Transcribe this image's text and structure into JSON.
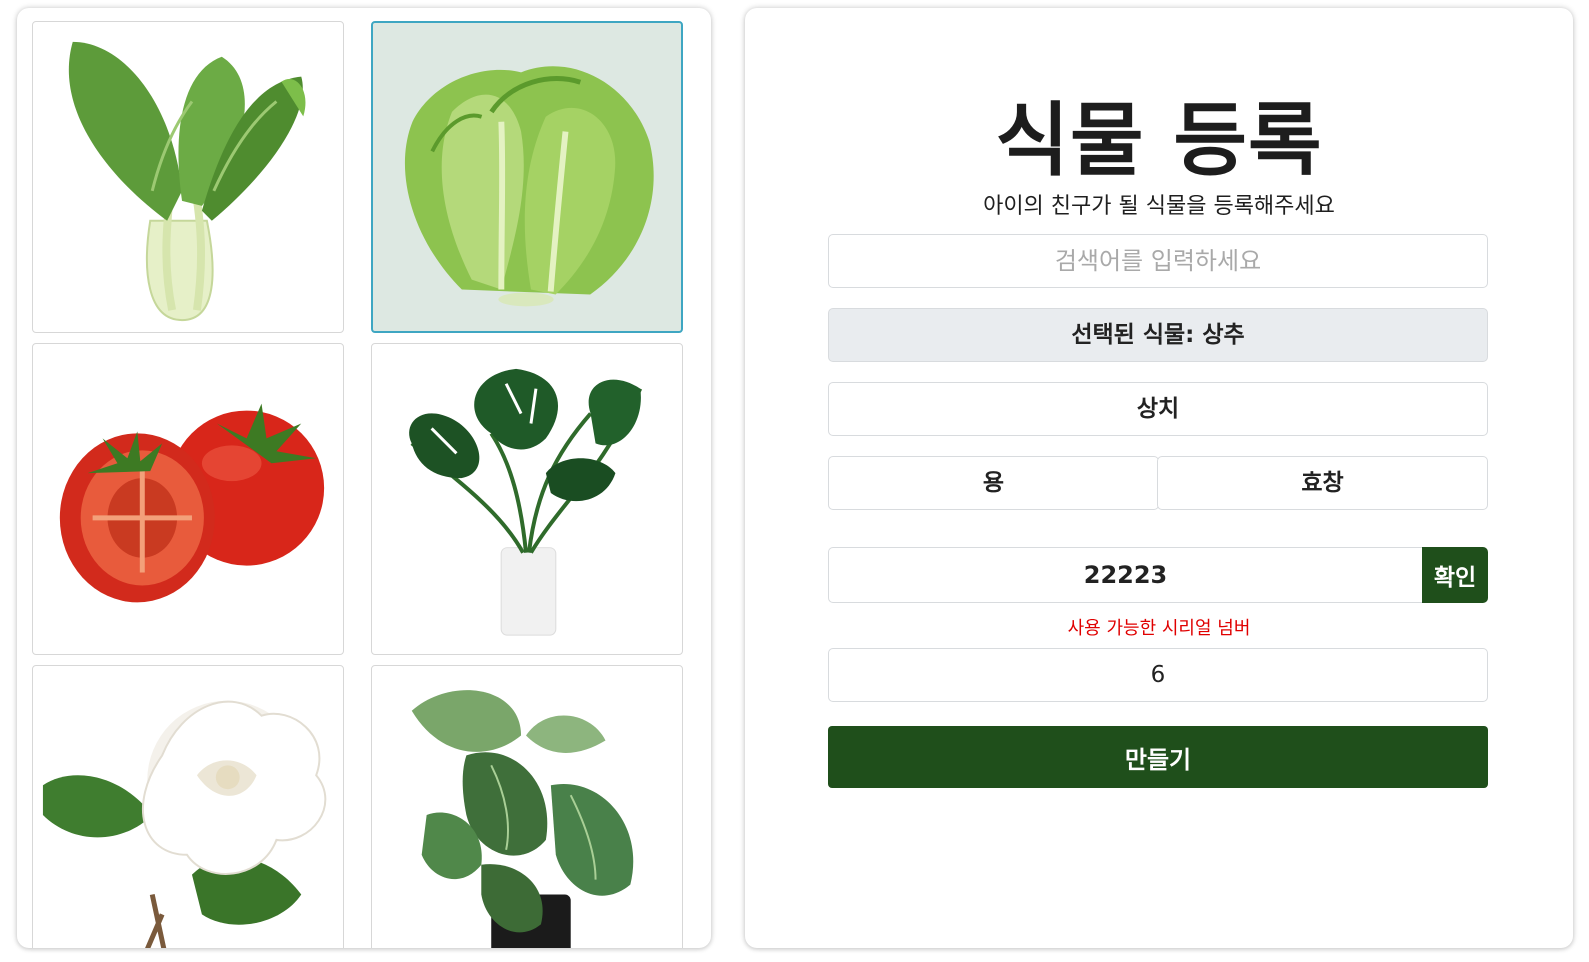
{
  "gallery": {
    "plants": [
      {
        "image": "bok-choy-image",
        "selected": false
      },
      {
        "image": "lettuce-image",
        "selected": true
      },
      {
        "image": "tomato-image",
        "selected": false
      },
      {
        "image": "monstera-plant-image",
        "selected": false
      },
      {
        "image": "gardenia-flower-image",
        "selected": false
      },
      {
        "image": "begonia-plant-image",
        "selected": false
      }
    ]
  },
  "form": {
    "title": "식물 등록",
    "subtitle": "아이의 친구가 될 식물을 등록해주세요",
    "search_placeholder": "검색어를 입력하세요",
    "selected_plant_label": "선택된 식물: 상추",
    "plant_name": "상치",
    "name_part_1": "용",
    "name_part_2": "효창",
    "serial_number": "22223",
    "confirm_label": "확인",
    "serial_status": "사용 가능한 시리얼 넘버",
    "extra_value": "6",
    "create_label": "만들기"
  },
  "colors": {
    "accent": "#1f4f1b",
    "selected_border": "#3ea6c2",
    "selected_bg": "#dde8e2",
    "error": "#e00000"
  }
}
